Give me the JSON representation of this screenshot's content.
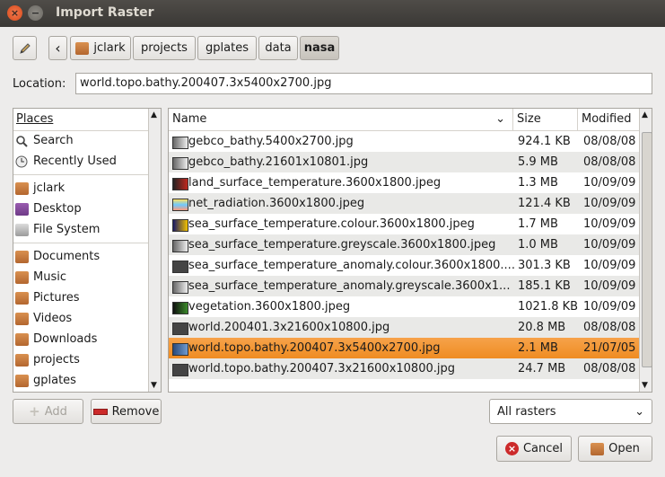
{
  "window": {
    "title": "Import Raster",
    "close_glyph": "×",
    "min_glyph": "−"
  },
  "path_bar": {
    "back_glyph": "‹",
    "segments": [
      {
        "label": "jclark",
        "has_icon": true
      },
      {
        "label": "projects"
      },
      {
        "label": "gplates"
      },
      {
        "label": "data"
      },
      {
        "label": "nasa",
        "active": true
      }
    ]
  },
  "location": {
    "label": "Location:",
    "value": "world.topo.bathy.200407.3x5400x2700.jpg"
  },
  "places": {
    "header": "Places",
    "items": [
      {
        "label": "Search",
        "icon": "search-icon"
      },
      {
        "label": "Recently Used",
        "icon": "clock-icon"
      },
      {
        "label": "jclark",
        "icon": "home-folder-icon"
      },
      {
        "label": "Desktop",
        "icon": "desktop-icon"
      },
      {
        "label": "File System",
        "icon": "drive-icon"
      },
      {
        "label": "Documents",
        "icon": "folder-icon"
      },
      {
        "label": "Music",
        "icon": "music-folder-icon"
      },
      {
        "label": "Pictures",
        "icon": "pictures-folder-icon"
      },
      {
        "label": "Videos",
        "icon": "videos-folder-icon"
      },
      {
        "label": "Downloads",
        "icon": "downloads-folder-icon"
      },
      {
        "label": "projects",
        "icon": "folder-icon"
      },
      {
        "label": "gplates",
        "icon": "folder-icon"
      }
    ]
  },
  "files": {
    "columns": {
      "name": "Name",
      "size": "Size",
      "modified": "Modified"
    },
    "rows": [
      {
        "name": "gebco_bathy.5400x2700.jpg",
        "size": "924.1 KB",
        "modified": "08/08/08"
      },
      {
        "name": "gebco_bathy.21601x10801.jpg",
        "size": "5.9 MB",
        "modified": "08/08/08"
      },
      {
        "name": "land_surface_temperature.3600x1800.jpeg",
        "size": "1.3 MB",
        "modified": "10/09/09"
      },
      {
        "name": "net_radiation.3600x1800.jpeg",
        "size": "121.4 KB",
        "modified": "10/09/09"
      },
      {
        "name": "sea_surface_temperature.colour.3600x1800.jpeg",
        "size": "1.7 MB",
        "modified": "10/09/09"
      },
      {
        "name": "sea_surface_temperature.greyscale.3600x1800.jpeg",
        "size": "1.0 MB",
        "modified": "10/09/09"
      },
      {
        "name": "sea_surface_temperature_anomaly.colour.3600x1800....",
        "size": "301.3 KB",
        "modified": "10/09/09"
      },
      {
        "name": "sea_surface_temperature_anomaly.greyscale.3600x1...",
        "size": "185.1 KB",
        "modified": "10/09/09"
      },
      {
        "name": "vegetation.3600x1800.jpeg",
        "size": "1021.8 KB",
        "modified": "10/09/09"
      },
      {
        "name": "world.200401.3x21600x10800.jpg",
        "size": "20.8 MB",
        "modified": "08/08/08"
      },
      {
        "name": "world.topo.bathy.200407.3x5400x2700.jpg",
        "size": "2.1 MB",
        "modified": "21/07/05",
        "selected": true
      },
      {
        "name": "world.topo.bathy.200407.3x21600x10800.jpg",
        "size": "24.7 MB",
        "modified": "08/08/08"
      }
    ]
  },
  "buttons": {
    "add": "Add",
    "remove": "Remove",
    "cancel": "Cancel",
    "open": "Open"
  },
  "filter": {
    "selected": "All rasters"
  },
  "colors": {
    "selection": "#ef8c22",
    "titlebar": "#3c3b37"
  }
}
